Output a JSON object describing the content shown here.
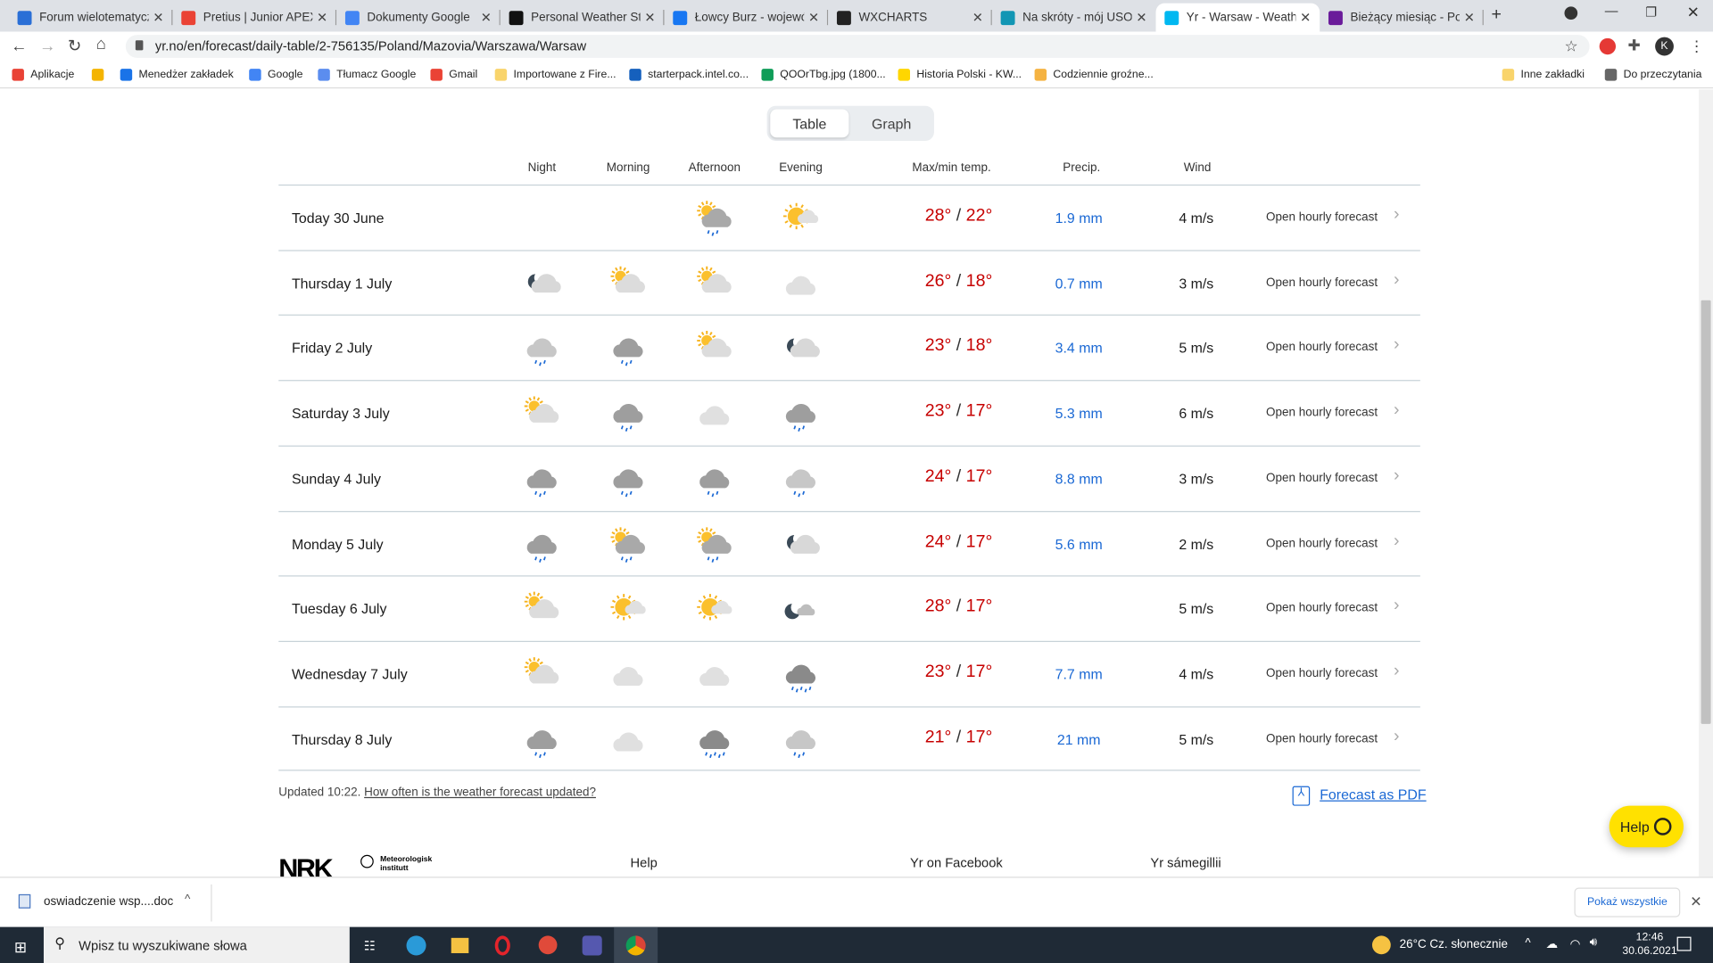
{
  "browser": {
    "tabs": [
      {
        "title": "Forum wielotematyczn",
        "color": "#2a6fd6"
      },
      {
        "title": "Pretius | Junior APEX D",
        "color": "#ea4335"
      },
      {
        "title": "Dokumenty Google",
        "color": "#4285f4"
      },
      {
        "title": "Personal Weather Stati",
        "color": "#111"
      },
      {
        "title": "Łowcy Burz - wojewódz",
        "color": "#1877f2"
      },
      {
        "title": "WXCHARTS",
        "color": "#222"
      },
      {
        "title": "Na skróty - mój USOSw",
        "color": "#1296b4"
      },
      {
        "title": "Yr - Warsaw - Weather",
        "color": "#00b8f1"
      },
      {
        "title": "Bieżący miesiąc - Pogo",
        "color": "#6a1b9a"
      }
    ],
    "active_tab": 7,
    "url": "yr.no/en/forecast/daily-table/2-756135/Poland/Mazovia/Warszawa/Warsaw",
    "bookmarks": [
      "Aplikacje",
      "",
      "Menedżer zakładek",
      "Google",
      "Tłumacz Google",
      "Gmail",
      "Importowane z Fire...",
      "starterpack.intel.co...",
      "QOOrTbg.jpg (1800...",
      "Historia Polski - KW...",
      "Codziennie groźne..."
    ],
    "bookmarks_right": [
      "Inne zakładki",
      "Do przeczytania"
    ],
    "avatar": "K"
  },
  "view_toggle": {
    "table": "Table",
    "graph": "Graph"
  },
  "columns": {
    "night": "Night",
    "morning": "Morning",
    "afternoon": "Afternoon",
    "evening": "Evening",
    "temp": "Max/min temp.",
    "precip": "Precip.",
    "wind": "Wind"
  },
  "rows": [
    {
      "date": "Today 30 June",
      "icons": [
        "",
        "",
        "partsun-rain",
        "fair-day"
      ],
      "max": "28°",
      "min": "22°",
      "precip": "1.9 mm",
      "wind": "4 m/s"
    },
    {
      "date": "Thursday 1 July",
      "icons": [
        "moon-cloud",
        "partsun-cloud",
        "partsun-cloud",
        "cloud-light"
      ],
      "max": "26°",
      "min": "18°",
      "precip": "0.7 mm",
      "wind": "3 m/s"
    },
    {
      "date": "Friday 2 July",
      "icons": [
        "rain-light",
        "rain",
        "partsun-cloud",
        "moon-cloud"
      ],
      "max": "23°",
      "min": "18°",
      "precip": "3.4 mm",
      "wind": "5 m/s"
    },
    {
      "date": "Saturday 3 July",
      "icons": [
        "partsun-cloud",
        "rain",
        "cloud-light",
        "rain"
      ],
      "max": "23°",
      "min": "17°",
      "precip": "5.3 mm",
      "wind": "6 m/s"
    },
    {
      "date": "Sunday 4 July",
      "icons": [
        "rain",
        "rain",
        "rain",
        "rain-light"
      ],
      "max": "24°",
      "min": "17°",
      "precip": "8.8 mm",
      "wind": "3 m/s"
    },
    {
      "date": "Monday 5 July",
      "icons": [
        "rain",
        "partsun-rain",
        "partsun-rain",
        "moon-cloud"
      ],
      "max": "24°",
      "min": "17°",
      "precip": "5.6 mm",
      "wind": "2 m/s"
    },
    {
      "date": "Tuesday 6 July",
      "icons": [
        "partsun-cloud",
        "fair-day",
        "fair-day",
        "moon-fair"
      ],
      "max": "28°",
      "min": "17°",
      "precip": "",
      "wind": "5 m/s"
    },
    {
      "date": "Wednesday 7 July",
      "icons": [
        "partsun-cloud",
        "cloud-light",
        "cloud-light",
        "heavy-rain"
      ],
      "max": "23°",
      "min": "17°",
      "precip": "7.7 mm",
      "wind": "4 m/s"
    },
    {
      "date": "Thursday 8 July",
      "icons": [
        "rain",
        "cloud-light",
        "heavy-rain",
        "rain-light"
      ],
      "max": "21°",
      "min": "17°",
      "precip": "21 mm",
      "wind": "5 m/s"
    }
  ],
  "open_hourly": "Open hourly forecast",
  "updated": "Updated 10:22.",
  "updated_link": "How often is the weather forecast updated?",
  "pdf_link": "Forecast as PDF",
  "help_button": "Help",
  "footer": {
    "nrk": "NRK",
    "met": "Meteorologisk institutt",
    "links": [
      "Help",
      "Yr on Facebook",
      "Yr sámegillii"
    ]
  },
  "download": {
    "file": "oswiadczenie wsp....doc",
    "show_all": "Pokaż wszystkie"
  },
  "taskbar": {
    "search": "Wpisz tu wyszukiwane słowa",
    "weather": "26°C  Cz. słonecznie",
    "time": "12:46",
    "date": "30.06.2021"
  },
  "colors": {
    "temp": "#c60000",
    "precip": "#1a68d4",
    "help": "#ffe100"
  }
}
